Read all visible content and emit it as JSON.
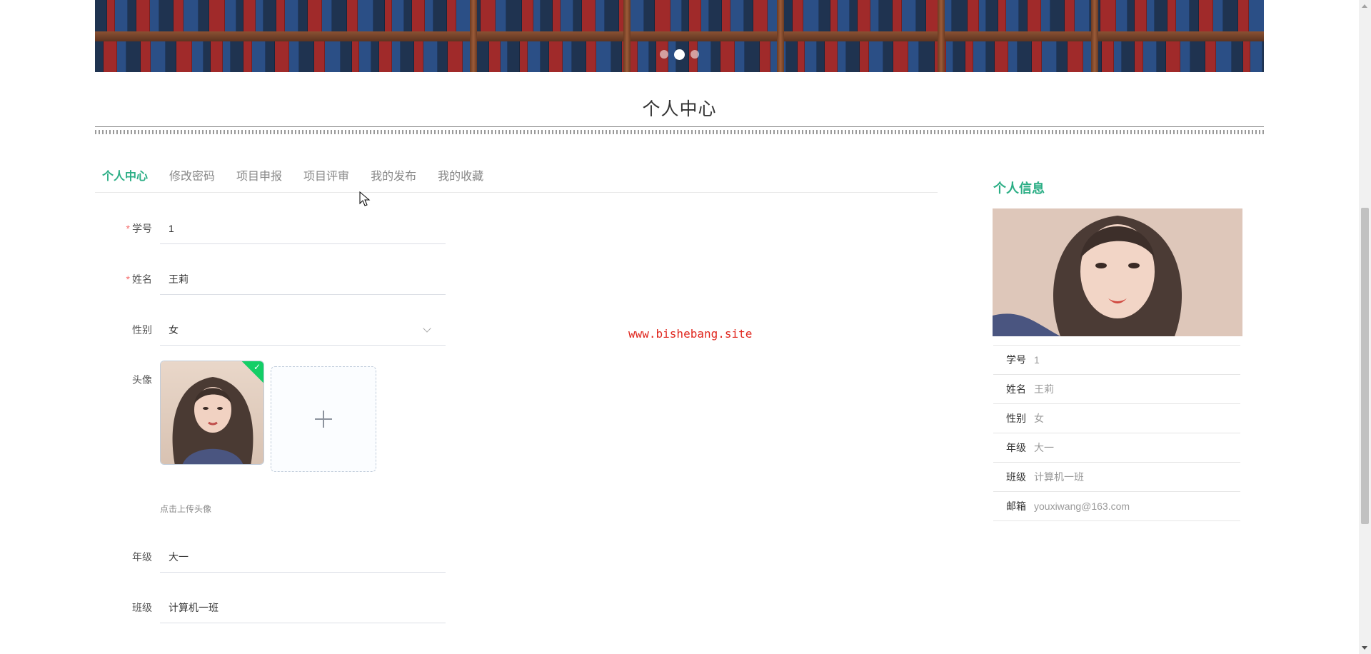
{
  "section_title": "个人中心",
  "tabs": [
    {
      "label": "个人中心",
      "active": true
    },
    {
      "label": "修改密码",
      "active": false
    },
    {
      "label": "项目申报",
      "active": false
    },
    {
      "label": "项目评审",
      "active": false
    },
    {
      "label": "我的发布",
      "active": false
    },
    {
      "label": "我的收藏",
      "active": false
    }
  ],
  "form": {
    "student_id": {
      "label": "学号",
      "value": "1",
      "required": true
    },
    "name": {
      "label": "姓名",
      "value": "王莉",
      "required": true
    },
    "gender": {
      "label": "性别",
      "value": "女"
    },
    "avatar": {
      "label": "头像",
      "hint": "点击上传头像"
    },
    "grade": {
      "label": "年级",
      "value": "大一"
    },
    "class": {
      "label": "班级",
      "value": "计算机一班"
    }
  },
  "watermark": "www.bishebang.site",
  "info_panel": {
    "title": "个人信息",
    "items": [
      {
        "key": "学号",
        "value": "1"
      },
      {
        "key": "姓名",
        "value": "王莉"
      },
      {
        "key": "性别",
        "value": "女"
      },
      {
        "key": "年级",
        "value": "大一"
      },
      {
        "key": "班级",
        "value": "计算机一班"
      },
      {
        "key": "邮箱",
        "value": "youxiwang@163.com"
      }
    ]
  },
  "carousel": {
    "slide_count": 3,
    "active_index": 1
  },
  "colors": {
    "accent": "#2bae85",
    "required": "#f56c6c",
    "watermark": "#e0261d",
    "success": "#13ce66"
  },
  "icons": [
    "plus-icon",
    "check-icon",
    "chevron-down-icon",
    "mouse-cursor-icon"
  ]
}
